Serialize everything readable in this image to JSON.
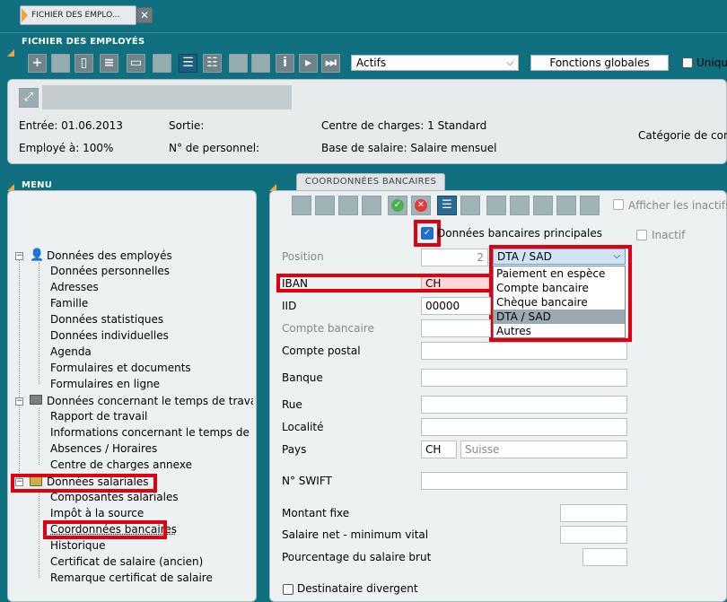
{
  "tab": {
    "title": "FICHIER DES EMPLO...",
    "close": "✕"
  },
  "window_title": "FICHIER DES EMPLOYÉS",
  "toolbar": {
    "filter_value": "Actifs",
    "global_functions": "Fonctions globales",
    "unique_label": "Unique"
  },
  "employee": {
    "entry": "Entrée: 01.06.2013",
    "exit": "Sortie:",
    "cost_center": "Centre de charges: 1 Standard",
    "employed_at": "Employé à: 100%",
    "personnel_no": "N° de personnel:",
    "salary_base": "Base de salaire: Salaire mensuel",
    "category": "Catégorie de contr"
  },
  "menu": {
    "title": "MENU",
    "groups": [
      {
        "label": "Données des employés",
        "children": [
          "Données personnelles",
          "Adresses",
          "Famille",
          "Données statistiques",
          "Données individuelles",
          "Agenda",
          "Formulaires et documents",
          "Formulaires en ligne"
        ]
      },
      {
        "label": "Données concernant le temps de travail",
        "children": [
          "Rapport de travail",
          "Informations concernant le temps de trav",
          "Absences / Horaires",
          "Centre de charges annexe"
        ]
      },
      {
        "label": "Données salariales",
        "children": [
          "Composantes salariales",
          "Impôt à la source",
          "Coordonnées bancaires",
          "Historique",
          "Certificat de salaire (ancien)",
          "Remarque certificat de salaire"
        ]
      }
    ]
  },
  "bank": {
    "tab_title": "COORDONNÉES BANCAIRES",
    "show_inactive": "Afficher les inactifs",
    "main_bank_data": "Données bancaires principales",
    "inactive": "Inactif",
    "position_label": "Position",
    "position_value": "2",
    "type_selected": "DTA / SAD",
    "type_options": [
      "Paiement en espèce",
      "Compte bancaire",
      "Chèque bancaire",
      "DTA / SAD",
      "Autres"
    ],
    "iban_label": "IBAN",
    "iban_value": "CH",
    "iid_label": "IID",
    "iid_value": "00000",
    "bank_account_label": "Compte bancaire",
    "postal_account_label": "Compte postal",
    "bank_label": "Banque",
    "street_label": "Rue",
    "city_label": "Localité",
    "country_label": "Pays",
    "country_code": "CH",
    "country_name": "Suisse",
    "swift_label": "N° SWIFT",
    "fixed_amount_label": "Montant fixe",
    "net_salary_min_label": "Salaire net - minimum vital",
    "gross_pct_label": "Pourcentage du salaire brut",
    "divergent_recipient": "Destinataire divergent"
  },
  "colors": {
    "background": "#10707f",
    "highlight": "#e00010",
    "accent": "#f2a33a"
  }
}
